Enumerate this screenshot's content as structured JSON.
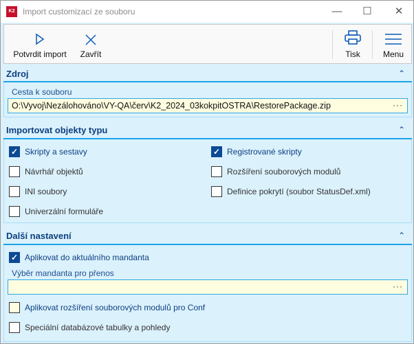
{
  "window": {
    "title": "Import customizací ze souboru",
    "logo": "K2"
  },
  "toolbar": {
    "confirm": "Potvrdit import",
    "close": "Zavřít",
    "print": "Tisk",
    "menu": "Menu"
  },
  "sections": {
    "source": {
      "title": "Zdroj",
      "path_label": "Cesta k souboru",
      "path_value": "O:\\Vyvoj\\Nezálohováno\\VY-QA\\červ\\K2_2024_03kokpitOSTRA\\RestorePackage.zip",
      "browse": "···"
    },
    "import_types": {
      "title": "Importovat objekty typu",
      "items": [
        {
          "label": "Skripty a sestavy",
          "checked": true
        },
        {
          "label": "Registrované skripty",
          "checked": true
        },
        {
          "label": "Návrhář objektů",
          "checked": false
        },
        {
          "label": "Rozšíření souborových modulů",
          "checked": false
        },
        {
          "label": "INI soubory",
          "checked": false
        },
        {
          "label": "Definice pokrytí (soubor StatusDef.xml)",
          "checked": false
        },
        {
          "label": "Univerzální formuláře",
          "checked": false
        }
      ]
    },
    "more": {
      "title": "Další nastavení",
      "apply_current": {
        "label": "Aplikovat do aktuálního mandanta",
        "checked": true
      },
      "mandant_label": "Výběr mandanta pro přenos",
      "mandant_value": "",
      "browse": "···",
      "apply_ext": {
        "label": "Aplikovat rozšíření souborových modulů pro Conf",
        "checked": false
      },
      "special_db": {
        "label": "Speciální databázové tabulky a pohledy",
        "checked": false
      }
    }
  }
}
